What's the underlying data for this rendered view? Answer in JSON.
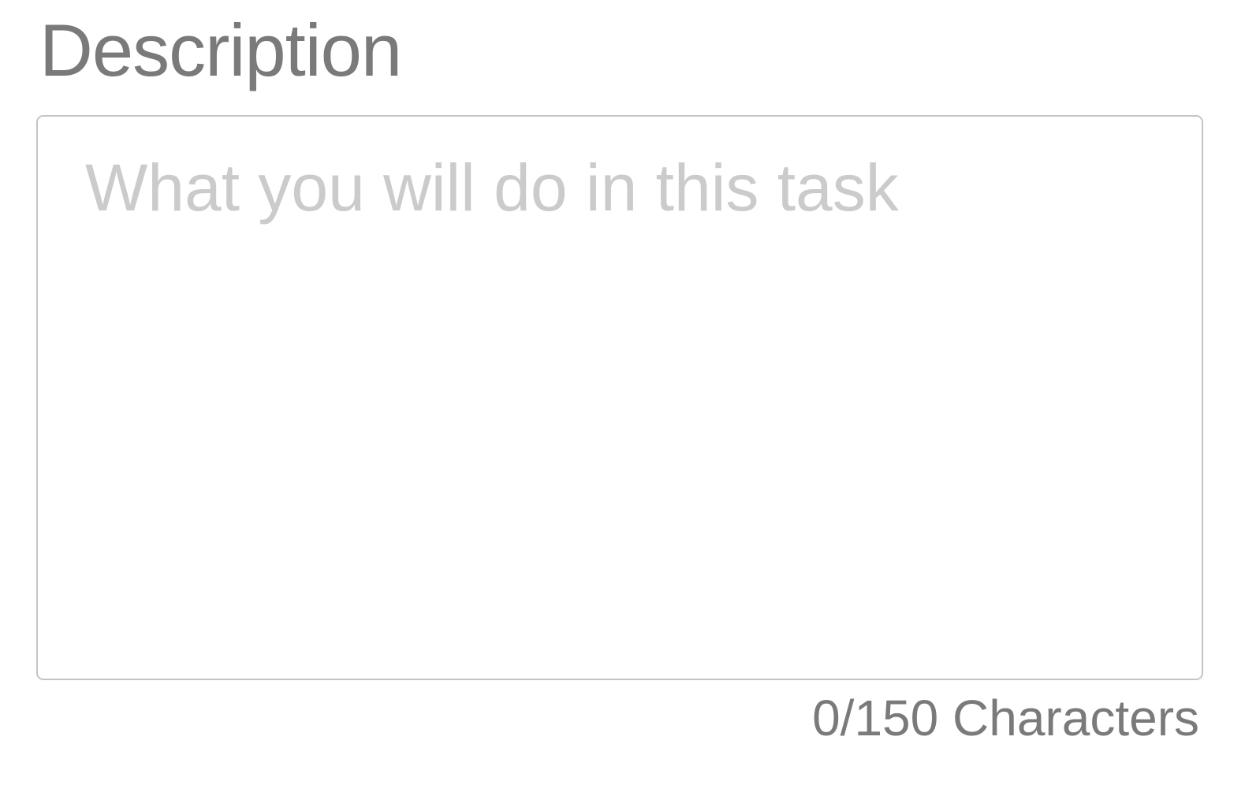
{
  "description_field": {
    "label": "Description",
    "placeholder": "What you will do in this task",
    "value": "",
    "counter_text": "0/150 Characters"
  },
  "colors": {
    "label": "#7a7a7a",
    "placeholder": "#cbcbcb",
    "border": "#c4c4c4",
    "counter": "#7a7a7a",
    "background": "#ffffff"
  }
}
